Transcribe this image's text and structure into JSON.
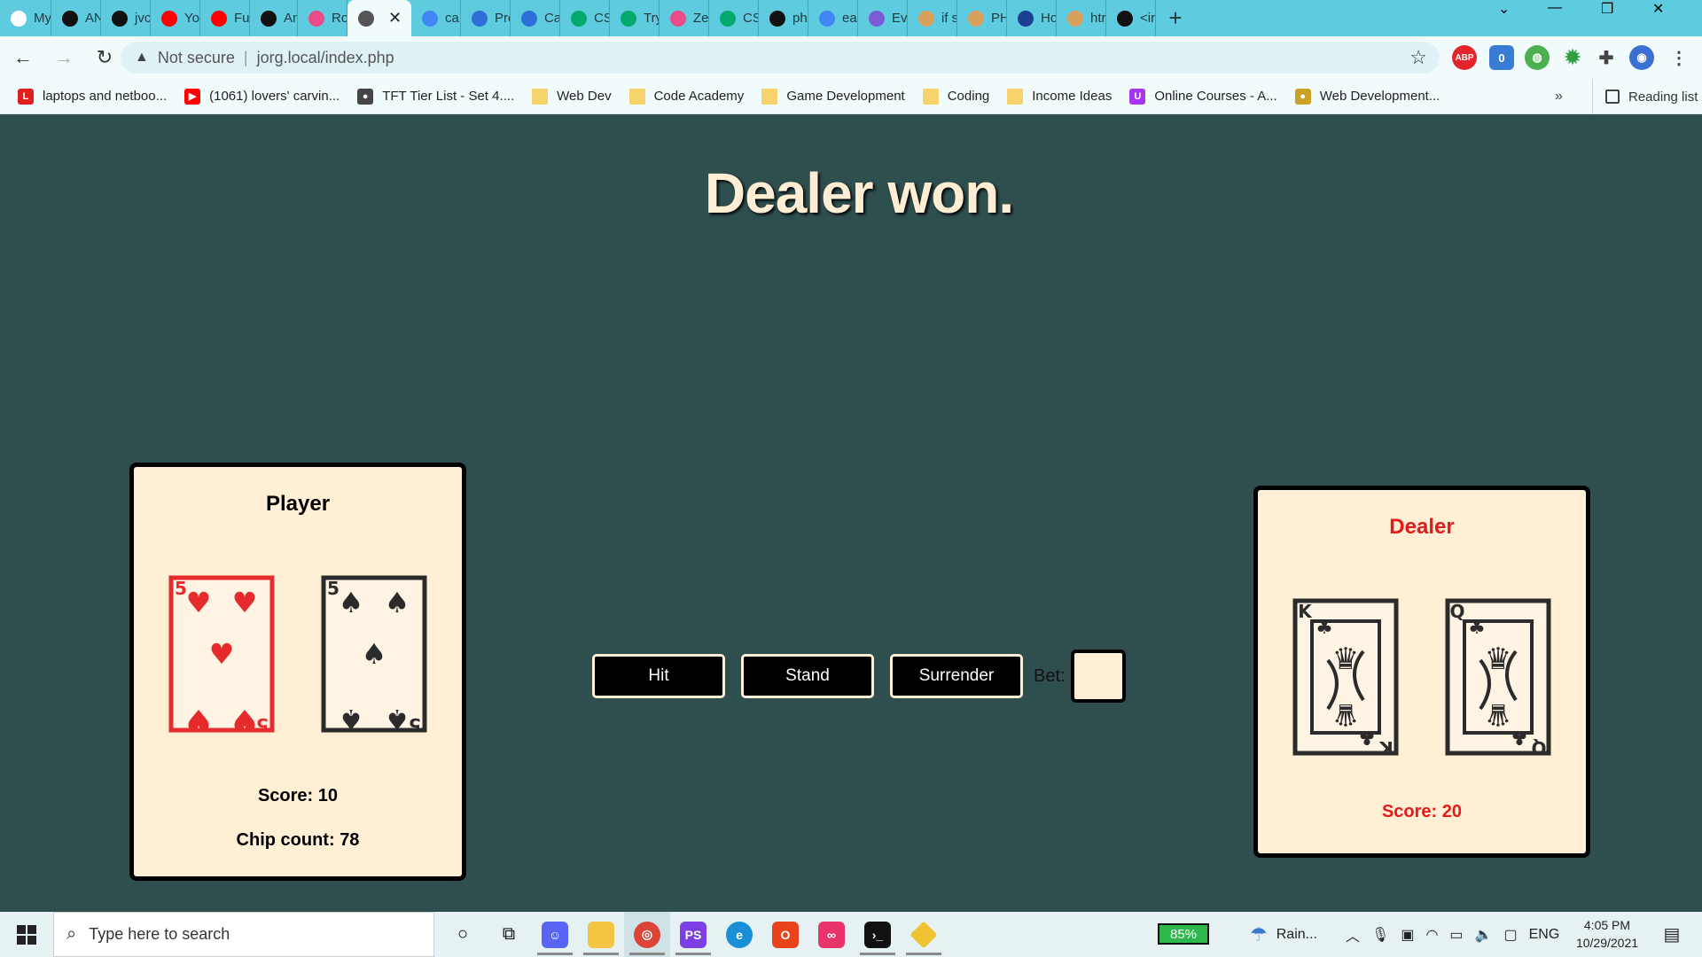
{
  "browser": {
    "tabs": [
      {
        "label": "My",
        "icon": "be-icon",
        "color": "#ffffff"
      },
      {
        "label": "AN",
        "icon": "github-icon",
        "color": "#111111"
      },
      {
        "label": "jvc",
        "icon": "github-icon",
        "color": "#111111"
      },
      {
        "label": "Yo",
        "icon": "youtube-icon",
        "color": "#ff0000"
      },
      {
        "label": "Fu",
        "icon": "youtube-icon",
        "color": "#ff0000"
      },
      {
        "label": "An",
        "icon": "diamond-icon",
        "color": "#111111"
      },
      {
        "label": "Ro",
        "icon": "puzzle-icon",
        "color": "#ea4c89"
      },
      {
        "label": "",
        "icon": "globe-icon",
        "color": "#555555",
        "active": true
      },
      {
        "label": "ca",
        "icon": "google-icon",
        "color": "#4285f4"
      },
      {
        "label": "Pre",
        "icon": "owl-icon",
        "color": "#2d6fd6"
      },
      {
        "label": "Ca",
        "icon": "owl-icon",
        "color": "#2d6fd6"
      },
      {
        "label": "CS",
        "icon": "w3-icon",
        "color": "#04aa6d"
      },
      {
        "label": "Try",
        "icon": "w3-icon",
        "color": "#04aa6d"
      },
      {
        "label": "Ze",
        "icon": "puzzle-icon",
        "color": "#ea4c89"
      },
      {
        "label": "CS",
        "icon": "w3-icon",
        "color": "#04aa6d"
      },
      {
        "label": "ph",
        "icon": "github-icon",
        "color": "#111111"
      },
      {
        "label": "ea",
        "icon": "google-icon",
        "color": "#4285f4"
      },
      {
        "label": "Ev",
        "icon": "lines-icon",
        "color": "#7b5cd6"
      },
      {
        "label": "if s",
        "icon": "feather-icon",
        "color": "#d9a05b"
      },
      {
        "label": "PH",
        "icon": "feather-icon",
        "color": "#d9a05b"
      },
      {
        "label": "Ho",
        "icon": "h-icon",
        "color": "#1c3f94"
      },
      {
        "label": "htr",
        "icon": "feather-icon",
        "color": "#d9a05b"
      },
      {
        "label": "<ir",
        "icon": "square-icon",
        "color": "#111111"
      }
    ],
    "new_tab": "+",
    "address": {
      "security": "Not secure",
      "url": "jorg.local/index.php"
    },
    "bookmarks": [
      {
        "label": "laptops and netboo...",
        "icon": "L",
        "color": "#e02020"
      },
      {
        "label": "(1061) lovers' carvin...",
        "icon": "▶",
        "color": "#ff0000"
      },
      {
        "label": "TFT Tier List - Set 4....",
        "icon": "●",
        "color": "#444444"
      },
      {
        "label": "Web Dev",
        "icon": "",
        "color": "#f6d36b",
        "folder": true
      },
      {
        "label": "Code Academy",
        "icon": "",
        "color": "#f6d36b",
        "folder": true
      },
      {
        "label": "Game Development",
        "icon": "",
        "color": "#f6d36b",
        "folder": true
      },
      {
        "label": "Coding",
        "icon": "",
        "color": "#f6d36b",
        "folder": true
      },
      {
        "label": "Income Ideas",
        "icon": "",
        "color": "#f6d36b",
        "folder": true
      },
      {
        "label": "Online Courses - A...",
        "icon": "U",
        "color": "#a435f0"
      },
      {
        "label": "Web Development...",
        "icon": "●",
        "color": "#c9a227"
      }
    ],
    "bookmarks_more": "»",
    "reading_list": "Reading list"
  },
  "game": {
    "result": "Dealer won.",
    "player": {
      "title": "Player",
      "score": "Score: 10",
      "chips": "Chip count: 78",
      "cards": [
        {
          "rank": "5",
          "suit": "hearts",
          "color": "#e52b2b"
        },
        {
          "rank": "5",
          "suit": "spades",
          "color": "#2b2b2b"
        }
      ]
    },
    "dealer": {
      "title": "Dealer",
      "score": "Score: 20",
      "cards": [
        {
          "rank": "K",
          "suit": "clubs",
          "color": "#2b2b2b"
        },
        {
          "rank": "Q",
          "suit": "clubs",
          "color": "#2b2b2b"
        }
      ]
    },
    "controls": {
      "hit": "Hit",
      "stand": "Stand",
      "surrender": "Surrender",
      "bet_label": "Bet:",
      "bet_value": ""
    }
  },
  "taskbar": {
    "search_placeholder": "Type here to search",
    "battery": "85%",
    "weather": "Rain...",
    "language": "ENG",
    "time": "4:05 PM",
    "date": "10/29/2021"
  }
}
